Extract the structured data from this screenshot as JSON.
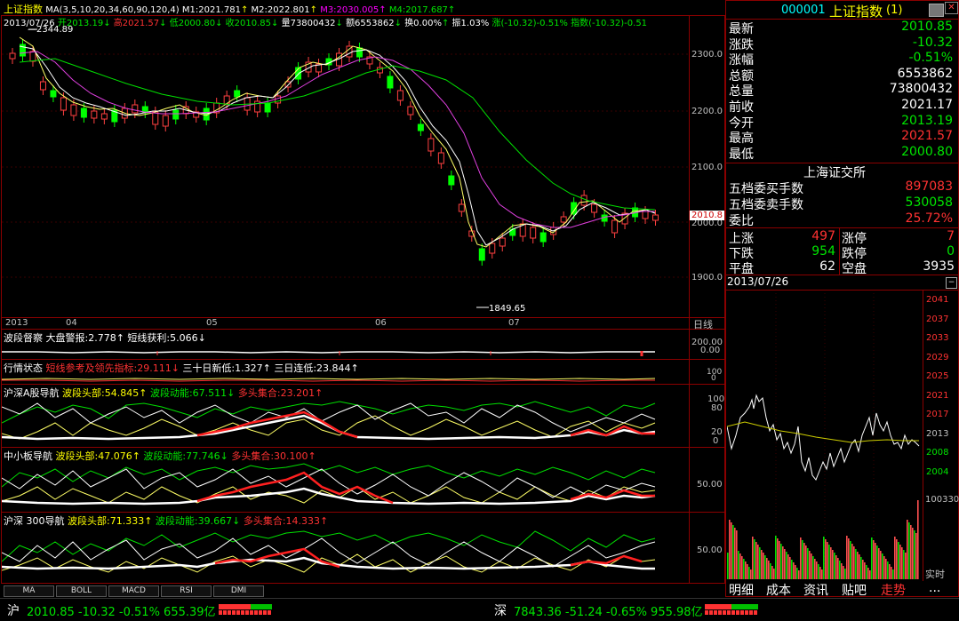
{
  "header": {
    "index_name": "上证指数",
    "ma_label": "MA(3,5,10,20,34,60,90,120,4)",
    "m1": "M1:2021.781",
    "m2": "M2:2022.801",
    "m3": "M3:2030.005",
    "m4": "M4:2017.687",
    "date": "2013/07/26",
    "open": "开2013.19",
    "high": "高2021.57",
    "low": "低2000.80",
    "close": "收2010.85",
    "vol": "量73800432",
    "amount": "额6553862",
    "turnover": "换0.00%",
    "amplitude": "振1.03%",
    "change": "涨(-10.32)-0.51%",
    "index_chg": "指数(-10.32)-0.51"
  },
  "price_axis": {
    "labels": [
      "2300.0",
      "2200.0",
      "2100.0",
      "2000.0",
      "1900.0"
    ],
    "current": "2010.8",
    "high_label": "2344.89",
    "low_label": "1849.65"
  },
  "date_axis": {
    "labels": [
      "2013",
      "04",
      "05",
      "06",
      "07"
    ],
    "period": "日线"
  },
  "indicators": {
    "i1": {
      "name": "波段督察",
      "p1": "大盘警报:2.778",
      "p2": "短线获利:5.066",
      "axis": [
        "200.00",
        "0.00"
      ]
    },
    "i2": {
      "name": "行情状态",
      "p1": "短线参考及领先指标:29.111",
      "p2": "三十日新低:1.327",
      "p3": "三日连低:23.844",
      "axis": [
        "100",
        "0"
      ]
    },
    "i3": {
      "name": "沪深A股导航",
      "p1": "波段头部:54.845",
      "p2": "波段动能:67.511",
      "p3": "多头集合:23.201",
      "axis": [
        "100",
        "80",
        "20",
        "0"
      ]
    },
    "i4": {
      "name": "中小板导航",
      "p1": "波段头部:47.076",
      "p2": "波段动能:77.746",
      "p3": "多头集合:30.100",
      "axis": [
        "50.00"
      ]
    },
    "i5": {
      "name": "沪深 300导航",
      "p1": "波段头部:71.333",
      "p2": "波段动能:39.667",
      "p3": "多头集合:14.333",
      "axis": [
        "50.00"
      ]
    }
  },
  "bottom_tabs": [
    "MA",
    "BOLL",
    "MACD",
    "RSI",
    "DMI"
  ],
  "right": {
    "code": "000001",
    "name": "上证指数",
    "suffix": "(1)",
    "quotes": [
      {
        "label": "最新",
        "value": "2010.85",
        "color": "#00e600"
      },
      {
        "label": "涨跌",
        "value": "-10.32",
        "color": "#00e600"
      },
      {
        "label": "涨幅",
        "value": "-0.51%",
        "color": "#00e600"
      },
      {
        "label": "总额",
        "value": "6553862",
        "color": "#ffffff"
      },
      {
        "label": "总量",
        "value": "73800432",
        "color": "#ffffff"
      },
      {
        "label": "前收",
        "value": "2021.17",
        "color": "#ffffff"
      },
      {
        "label": "今开",
        "value": "2013.19",
        "color": "#00e600"
      },
      {
        "label": "最高",
        "value": "2021.57",
        "color": "#ff3232"
      },
      {
        "label": "最低",
        "value": "2000.80",
        "color": "#00e600"
      }
    ],
    "exchange": "上海证交所",
    "orders": [
      {
        "label": "五档委买手数",
        "value": "897083",
        "color": "#ff3232"
      },
      {
        "label": "五档委卖手数",
        "value": "530058",
        "color": "#00e600"
      },
      {
        "label": "委比",
        "value": "25.72%",
        "color": "#ff3232"
      }
    ],
    "breadth": [
      {
        "l1": "上涨",
        "v1": "497",
        "c1": "#ff3232",
        "l2": "涨停",
        "v2": "7",
        "c2": "#ff3232"
      },
      {
        "l1": "下跌",
        "v1": "954",
        "c1": "#00e600",
        "l2": "跌停",
        "v2": "0",
        "c2": "#00e600"
      },
      {
        "l1": "平盘",
        "v1": "62",
        "c1": "#ffffff",
        "l2": "空盘",
        "v2": "3935",
        "c2": "#ffffff"
      }
    ],
    "mini_date": "2013/07/26",
    "mini_axis": [
      "2041",
      "2037",
      "2033",
      "2029",
      "2025",
      "2021",
      "2017",
      "2013",
      "2008",
      "2004"
    ],
    "vol_axis": "100330",
    "realtime": "实时",
    "tabs": [
      "明细",
      "成本",
      "资讯",
      "贴吧",
      "走势",
      "..."
    ]
  },
  "status": {
    "sh_label": "沪",
    "sh_text": "2010.85 -10.32 -0.51% 655.39亿",
    "sz_label": "深",
    "sz_text": "7843.36 -51.24 -0.65% 955.98亿"
  }
}
